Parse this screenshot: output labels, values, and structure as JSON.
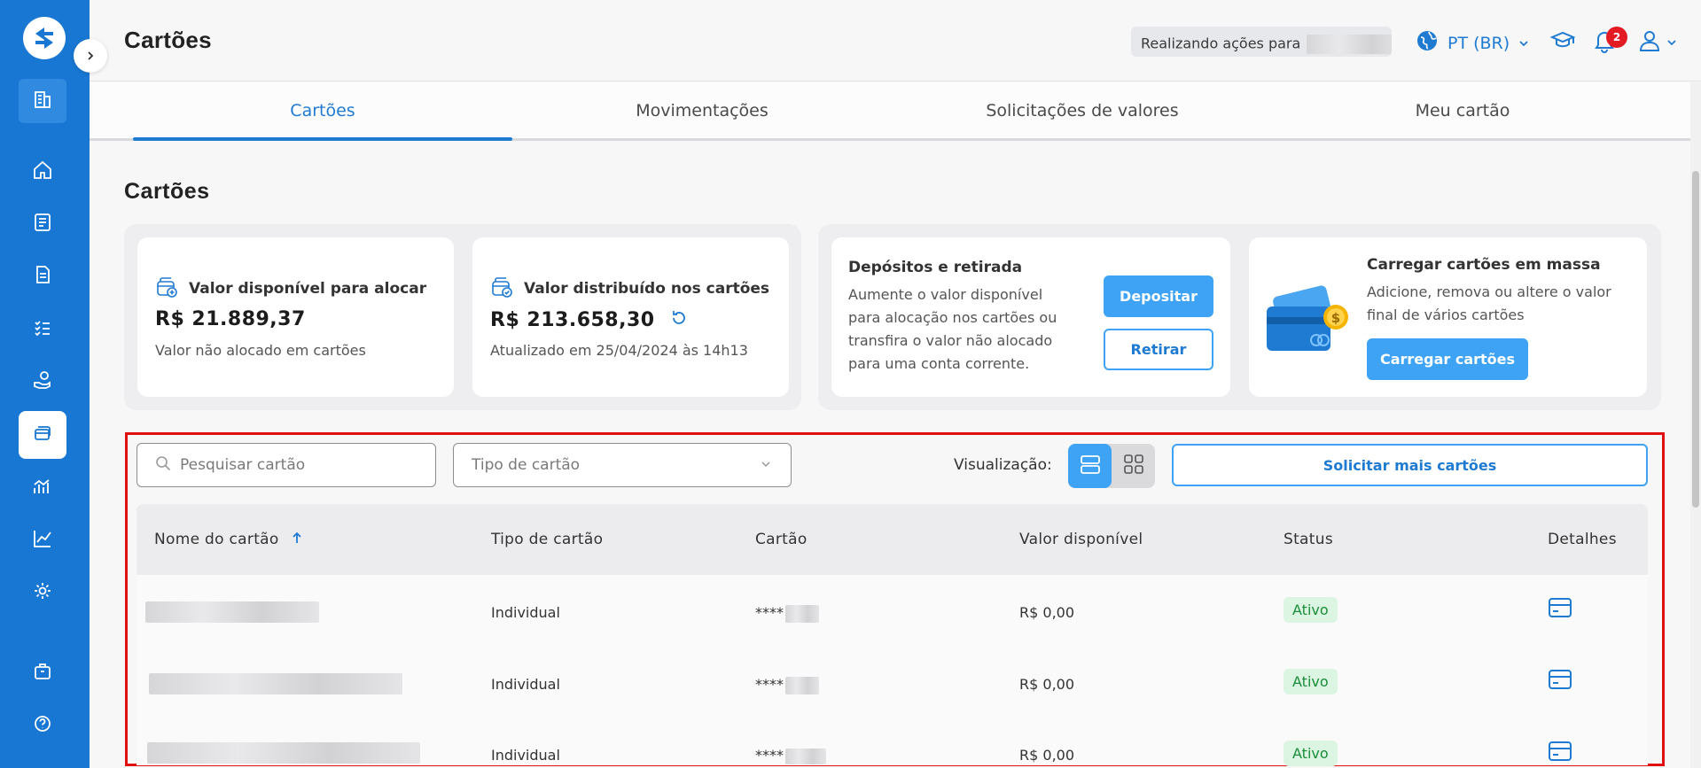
{
  "header": {
    "title": "Cartões",
    "acting_label": "Realizando ações para",
    "language": "PT (BR)",
    "notification_count": "2"
  },
  "tabs": [
    {
      "label": "Cartões"
    },
    {
      "label": "Movimentações"
    },
    {
      "label": "Solicitações de valores"
    },
    {
      "label": "Meu cartão"
    }
  ],
  "section": {
    "title": "Cartões"
  },
  "summary": {
    "available": {
      "label": "Valor disponível para alocar",
      "value": "R$ 21.889,37",
      "sub": "Valor não alocado em cartões"
    },
    "distributed": {
      "label": "Valor distribuído nos cartões",
      "value": "R$ 213.658,30",
      "sub": "Atualizado em 25/04/2024 às 14h13"
    }
  },
  "deposits": {
    "title": "Depósitos e retirada",
    "desc": [
      "Aumente o valor disponível",
      "para alocação nos cartões ou",
      "transfira o valor não alocado",
      "para uma conta corrente."
    ],
    "deposit_label": "Depositar",
    "withdraw_label": "Retirar"
  },
  "bulk": {
    "title": "Carregar cartões em massa",
    "desc": [
      "Adicione, remova ou altere o valor",
      "final de vários cartões"
    ],
    "button_label": "Carregar cartões"
  },
  "filters": {
    "search_placeholder": "Pesquisar cartão",
    "type_placeholder": "Tipo de cartão",
    "view_label": "Visualização:",
    "request_label": "Solicitar mais cartões"
  },
  "table": {
    "headers": [
      "Nome do cartão",
      "Tipo de cartão",
      "Cartão",
      "Valor disponível",
      "Status",
      "Detalhes"
    ],
    "rows": [
      {
        "type": "Individual",
        "card": "****",
        "value": "R$ 0,00",
        "status": "Ativo"
      },
      {
        "type": "Individual",
        "card": "****",
        "value": "R$ 0,00",
        "status": "Ativo"
      },
      {
        "type": "Individual",
        "card": "****",
        "value": "R$ 0,00",
        "status": "Ativo"
      }
    ]
  },
  "colors": {
    "sidebar": "#1877d2",
    "accent": "#3ea3f5",
    "link": "#1f7bd2",
    "status_bg": "#dcf5e2",
    "status_text": "#1a8d3a",
    "highlight": "#e01010"
  },
  "icons": [
    "logo-icon",
    "chevron-right-icon",
    "building-icon",
    "home-icon",
    "list-icon",
    "document-icon",
    "checklist-icon",
    "hand-coin-icon",
    "cards-icon",
    "analytics-icon",
    "chart-line-icon",
    "gear-icon",
    "bag-icon",
    "help-icon",
    "globe-icon",
    "chevron-down-icon",
    "graduation-cap-icon",
    "bell-icon",
    "user-icon",
    "refresh-icon",
    "search-icon",
    "arrow-up-icon",
    "card-details-icon"
  ]
}
